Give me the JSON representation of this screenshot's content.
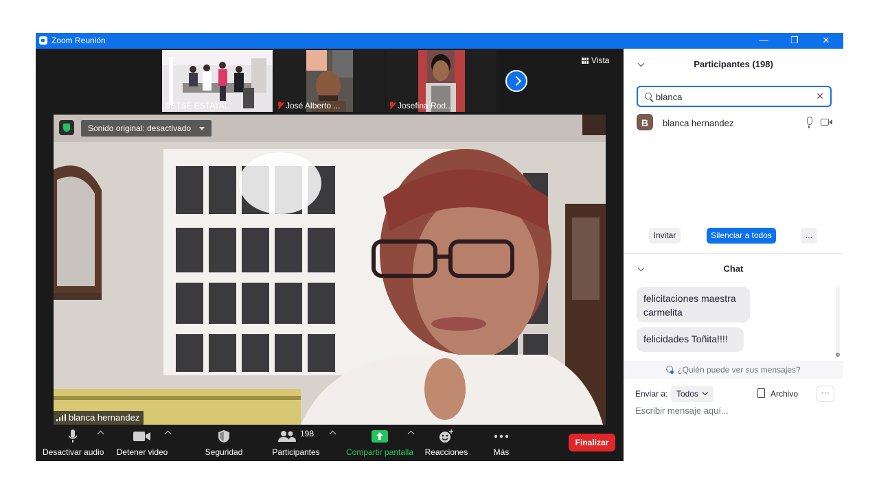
{
  "window": {
    "title": "Zoom Reunión",
    "minimize_glyph": "—",
    "restore_glyph": "❐",
    "close_glyph": "✕"
  },
  "thumbnails": [
    {
      "name": "SETSE ESTATAL",
      "muted": false
    },
    {
      "name": "José Alberto ...",
      "muted": true
    },
    {
      "name": "Josefina Rod...",
      "muted": true
    }
  ],
  "view_button": {
    "label": "Vista"
  },
  "main_video": {
    "sound_label": "Sonido original: desactivado",
    "speaker_name": "blanca hernandez"
  },
  "toolbar": {
    "audio": "Desactivar audio",
    "video": "Detener video",
    "security": "Seguridad",
    "participants": "Participantes",
    "participants_count": "198",
    "share": "Compartir pantalla",
    "reactions": "Reacciones",
    "more": "Más",
    "end": "Finalizar"
  },
  "participants_panel": {
    "title": "Participantes (198)",
    "search_value": "blanca",
    "list": [
      {
        "initial": "B",
        "name": "blanca hernandez"
      }
    ],
    "invite": "Invitar",
    "mute_all": "Silenciar a todos",
    "more": "..."
  },
  "chat_panel": {
    "title": "Chat",
    "messages": [
      {
        "text": "felicitaciones maestra carmelita"
      },
      {
        "text": "felicidades Toñita!!!!"
      }
    ],
    "who_can_see": "¿Quién puede ver sus mensajes?",
    "send_to_label": "Enviar a:",
    "send_to_value": "Todos",
    "file_label": "Archivo",
    "more": "···",
    "input_placeholder": "Escribir mensaje aquí..."
  },
  "colors": {
    "accent": "#0e71eb",
    "end": "#e02828",
    "share": "#22c55e",
    "toolbar_bg": "#1a1a1a"
  }
}
